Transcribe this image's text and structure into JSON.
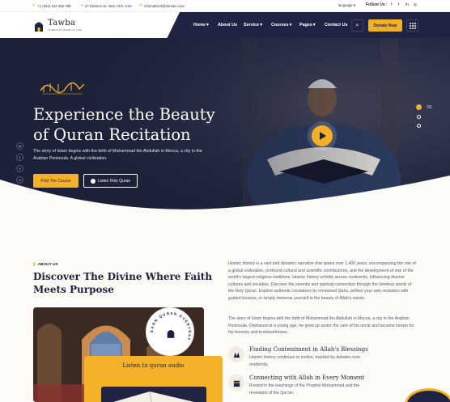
{
  "topbar": {
    "phone": "+1 (044) 123 456 789",
    "address": "27 Division St, New York, USA",
    "email": "infomail123@domain.com",
    "language": "language",
    "follow_us": "Follow Us :",
    "social": [
      "facebook-icon",
      "twitter-icon",
      "linkedin-icon",
      "instagram-icon"
    ]
  },
  "brand": {
    "name": "Tawba",
    "tagline": "COMPLETE SOME OF LIFE"
  },
  "nav": {
    "items": [
      {
        "label": "Home",
        "dropdown": true
      },
      {
        "label": "About Us",
        "dropdown": false
      },
      {
        "label": "Service",
        "dropdown": true
      },
      {
        "label": "Courses",
        "dropdown": true
      },
      {
        "label": "Pages",
        "dropdown": true
      },
      {
        "label": "Contact Us",
        "dropdown": false
      }
    ],
    "donate_label": "Donate Now"
  },
  "hero": {
    "title_line1": "Experience the Beauty",
    "title_line2": "of Quran Recitation",
    "description": "The story of Islam begins with the birth of Muhammad ibn Abdullah in Mecca, a city in the Arabian Peninsula. A global civilization.",
    "primary_button": "Find The Course",
    "secondary_button": "Listen Holy Quran",
    "slide_number": "01",
    "social": [
      "in",
      "f",
      "t",
      "o"
    ]
  },
  "about": {
    "tag": "ABOUT US",
    "title": "Discover The Divine Where Faith Meets Purpose",
    "paragraph1": "Islamic history is a vast and dynamic narrative that spans over 1,400 years, encompassing the rise of a global civilization, profound cultural and scientific contributions, and the development of one of the world's largest religious traditions. Islamic history unfolds across continents, influencing diverse cultures and societies. Discover the serenity and spiritual connection through the timeless words of the Holy Quran. Explore authentic recitations by renowned Qaris, perfect your own recitation with guided lessons, or simply immerse yourself in the beauty of Allah's words.",
    "paragraph2": "The story of Islam begins with the birth of Muhammad ibn Abdullah in Mecca, a city in the Arabian Peninsula. Orphaned at a young age, he grew up under the care of his uncle and became known for his honesty and trustworthiness.",
    "badge_text": "EARN QURAN EVERYDAY",
    "listen_label": "Listen to quran audio",
    "features": [
      {
        "icon": "hands-icon",
        "title": "Finding Contentment in Allah's Blessings",
        "desc": "Islamic history continues to evolve, marked by debates over modernity."
      },
      {
        "icon": "kaaba-icon",
        "title": "Connecting with Allah in Every Moment",
        "desc": "Rooted in the teachings of the Prophet Muhammad and the revelation of the Qur'an."
      }
    ]
  },
  "colors": {
    "accent": "#f3b12a",
    "navy": "#1e2442"
  }
}
